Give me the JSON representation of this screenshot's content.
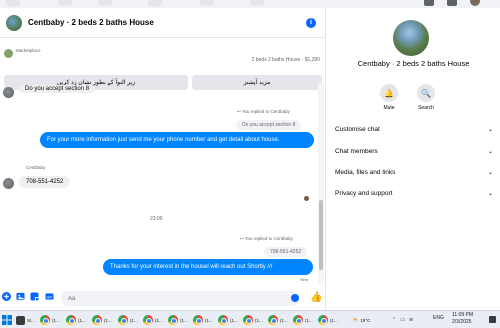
{
  "chat": {
    "title": "Centbaby · 2 beds 2 baths House",
    "marketplace_label": "Marketplace",
    "product_summary": "2 beds 2 baths House - $1,280",
    "quick_replies": [
      "زیر النوآ کے بطور نشان زد کریں",
      "مزید آپشنز"
    ],
    "messages": {
      "partial_quote": "Do you accept section 8",
      "reply_note_1": "You replied to Centbaby",
      "quoted_1": "Do you accept section 8",
      "out_1": "For your more information just send me  your phone number and get detail about house.",
      "sender_name": "Centbaby",
      "in_phone": "708-551-4252",
      "time_separator": "23:09",
      "reply_note_2": "You replied to Centbaby",
      "quoted_2": "708-551-4252",
      "out_2": "Thanks for your interest in the housel will reach out Shortly ///",
      "sent_label": "Sent"
    },
    "composer": {
      "placeholder": "Aa"
    }
  },
  "side": {
    "title": "Centbaby · 2 beds 2 baths House",
    "actions": [
      {
        "label": "Mute",
        "icon": "bell-icon"
      },
      {
        "label": "Search",
        "icon": "search-icon"
      }
    ],
    "sections": [
      "Customise chat",
      "Chat members",
      "Media, files and links",
      "Privacy and support"
    ]
  },
  "taskbar": {
    "items": [
      "Sl...",
      "(1...",
      "(1...",
      "(1...",
      "(1...",
      "(1...",
      "(1...",
      "(1...",
      "(1...",
      "(1...",
      "(1...",
      "(1...",
      "(1...",
      "(1...",
      "(1..."
    ],
    "weather": "19°C",
    "language": "ENG",
    "time": "11:09 PM",
    "date": "2/3/2025"
  },
  "colors": {
    "accent": "#0866ff",
    "outgoing_bubble": "#0084ff",
    "incoming_bubble": "#f0f0f0"
  }
}
